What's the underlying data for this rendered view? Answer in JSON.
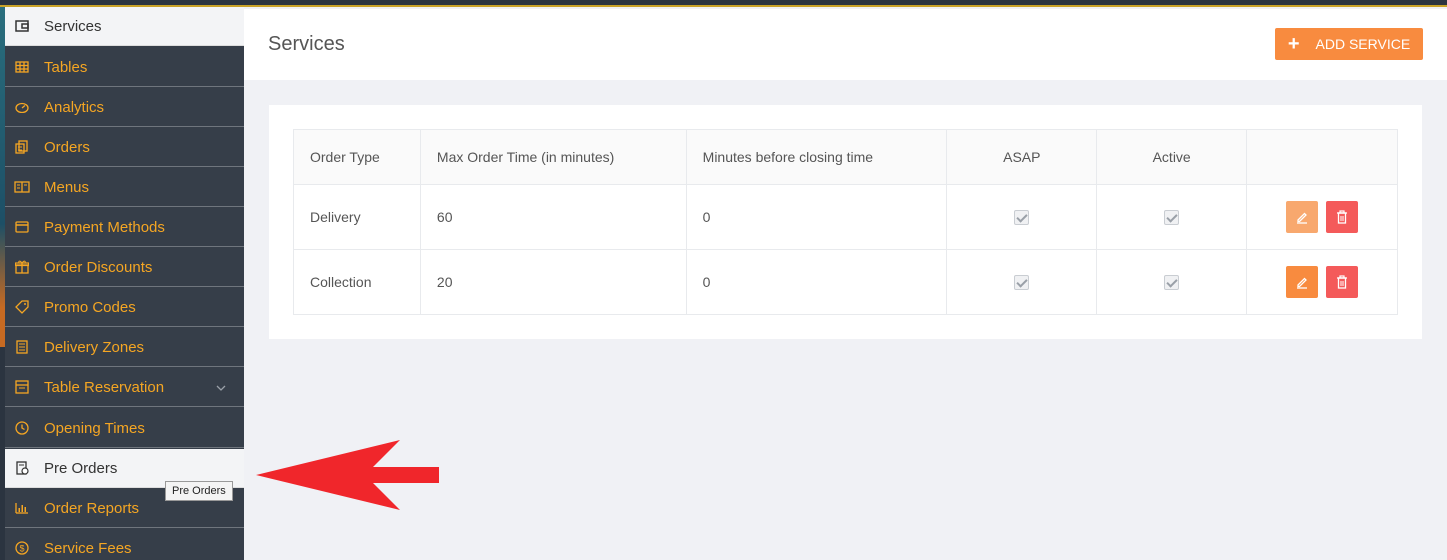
{
  "sidebar": {
    "items": [
      {
        "label": "Services",
        "icon": "wallet-icon",
        "active": true
      },
      {
        "label": "Tables",
        "icon": "table-grid-icon"
      },
      {
        "label": "Analytics",
        "icon": "gauge-icon"
      },
      {
        "label": "Orders",
        "icon": "orders-icon"
      },
      {
        "label": "Menus",
        "icon": "book-icon"
      },
      {
        "label": "Payment Methods",
        "icon": "credit-card-icon"
      },
      {
        "label": "Order Discounts",
        "icon": "gift-icon"
      },
      {
        "label": "Promo Codes",
        "icon": "tag-icon"
      },
      {
        "label": "Delivery Zones",
        "icon": "list-icon"
      },
      {
        "label": "Table Reservation",
        "icon": "reservation-icon",
        "has_submenu": true
      },
      {
        "label": "Opening Times",
        "icon": "clock-icon"
      },
      {
        "label": "Pre Orders",
        "icon": "pre-order-icon",
        "hover": true
      },
      {
        "label": "Order Reports",
        "icon": "bar-chart-icon"
      },
      {
        "label": "Service Fees",
        "icon": "dollar-circle-icon"
      }
    ],
    "tooltip": "Pre Orders"
  },
  "header": {
    "title": "Services",
    "add_button_label": "ADD SERVICE"
  },
  "table": {
    "columns": [
      "Order Type",
      "Max Order Time (in minutes)",
      "Minutes before closing time",
      "ASAP",
      "Active",
      ""
    ],
    "rows": [
      {
        "order_type": "Delivery",
        "max_order_time": "60",
        "minutes_before_closing": "0",
        "asap": true,
        "active": true
      },
      {
        "order_type": "Collection",
        "max_order_time": "20",
        "minutes_before_closing": "0",
        "asap": true,
        "active": true
      }
    ]
  },
  "colors": {
    "accent": "#f88b3f",
    "danger": "#f45a5a",
    "sidebar_bg": "#363e49",
    "sidebar_text": "#f5a623",
    "annotation_arrow": "#f0262b"
  }
}
